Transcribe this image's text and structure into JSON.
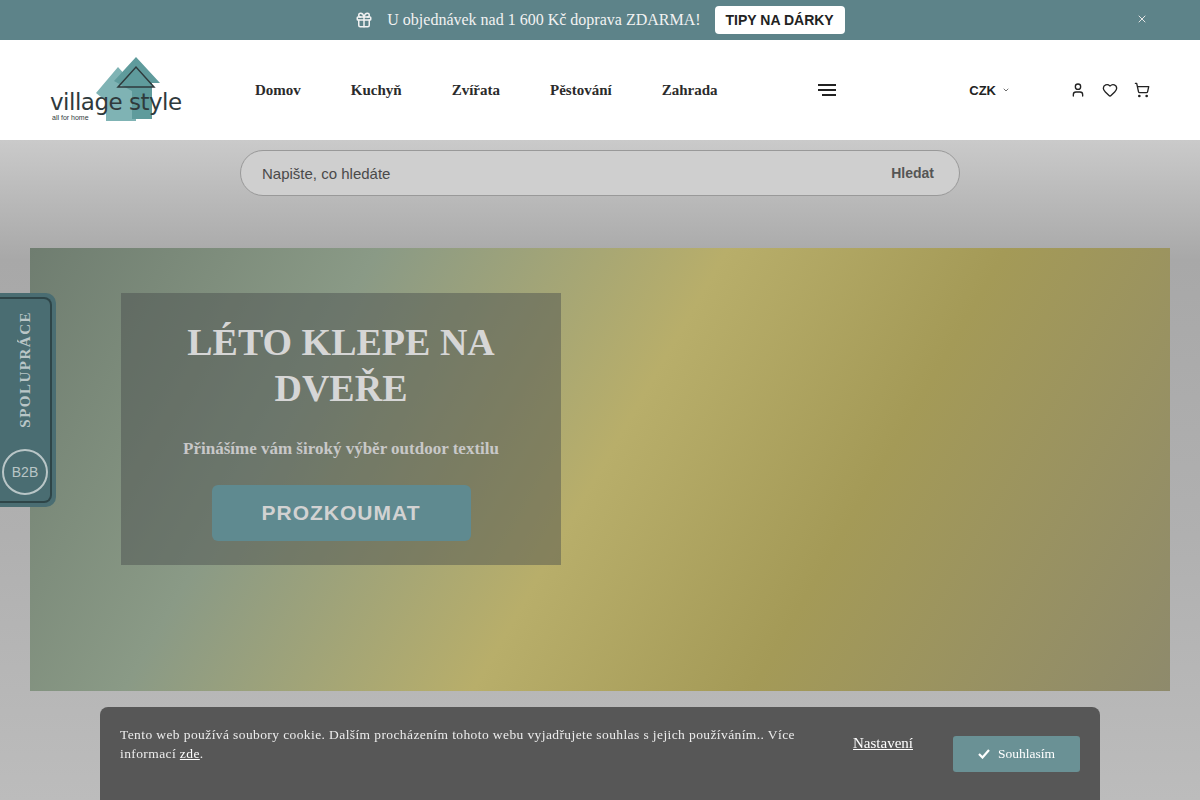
{
  "top_bar": {
    "message": "U objednávek nad 1 600 Kč doprava ZDARMA!",
    "button": "TIPY NA DÁRKY"
  },
  "logo": {
    "name": "village style",
    "tagline": "all for home"
  },
  "nav": [
    {
      "label": "Domov"
    },
    {
      "label": "Kuchyň"
    },
    {
      "label": "Zvířata"
    },
    {
      "label": "Pěstování"
    },
    {
      "label": "Zahrada"
    }
  ],
  "currency": "CZK",
  "search": {
    "placeholder": "Napište, co hledáte",
    "button": "Hledat"
  },
  "hero": {
    "title": "LÉTO KLEPE NA DVEŘE",
    "subtitle": "Přinášíme vám široký výběr outdoor textilu",
    "button": "PROZKOUMAT"
  },
  "side_tab": {
    "label": "SPOLUPRÁCE",
    "badge": "B2B"
  },
  "cookie_bar": {
    "text": "Tento web používá soubory cookie. Dalším procházením tohoto webu vyjadřujete souhlas s jejich používáním.. Více informací ",
    "link": "zde",
    "after": ".",
    "settings": "Nastavení",
    "accept": "Souhlasím"
  }
}
